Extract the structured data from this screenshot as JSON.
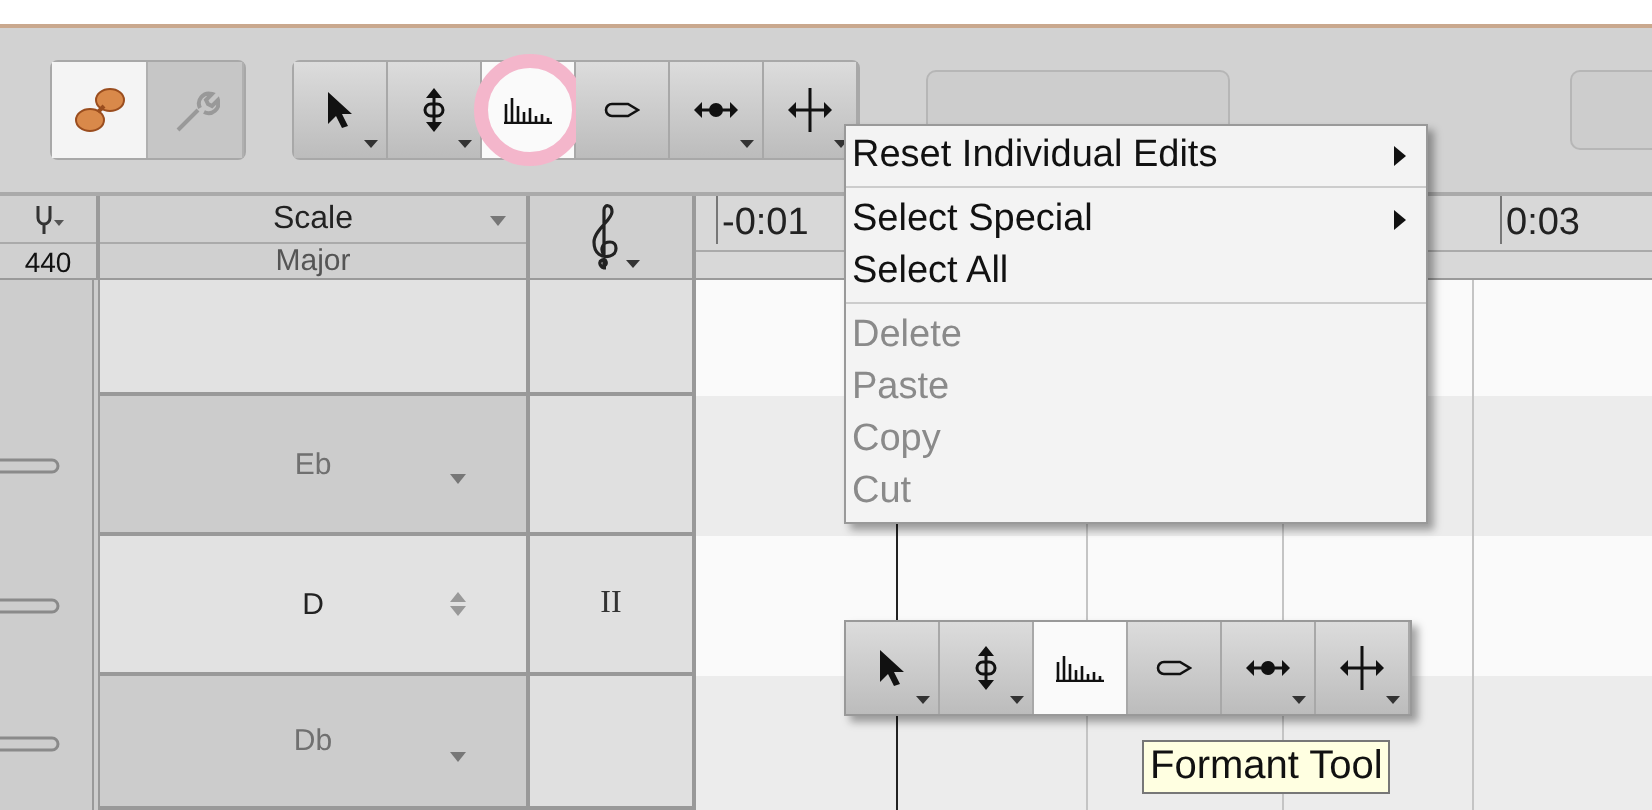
{
  "mode_toggles": [
    {
      "kind": "blobs",
      "selected": true
    },
    {
      "kind": "wrench",
      "selected": false
    }
  ],
  "tools": [
    {
      "kind": "pointer",
      "dropdown": true,
      "selected": false,
      "highlighted": false
    },
    {
      "kind": "pitch",
      "dropdown": true,
      "selected": false,
      "highlighted": false
    },
    {
      "kind": "formant",
      "dropdown": false,
      "selected": true,
      "highlighted": true
    },
    {
      "kind": "amplitude",
      "dropdown": false,
      "selected": false,
      "highlighted": false
    },
    {
      "kind": "timing",
      "dropdown": true,
      "selected": false,
      "highlighted": false
    },
    {
      "kind": "sibilant",
      "dropdown": true,
      "selected": false,
      "highlighted": false
    }
  ],
  "header": {
    "tuning": {
      "reference": "440"
    },
    "scale": {
      "label": "Scale",
      "value": "Major"
    },
    "ticks": [
      "-0:01",
      "0:03"
    ]
  },
  "rows": [
    {
      "in_scale": true
    },
    {
      "note": "Eb",
      "in_scale": false
    },
    {
      "note": "D",
      "in_scale": true,
      "degree": "II"
    },
    {
      "note": "Db",
      "in_scale": false
    }
  ],
  "context_menu": {
    "items": [
      {
        "label": "Reset Individual Edits",
        "submenu": true,
        "disabled": false,
        "separator_after": true
      },
      {
        "label": "Select Special",
        "submenu": true,
        "disabled": false,
        "separator_after": false
      },
      {
        "label": "Select All",
        "submenu": false,
        "disabled": false,
        "separator_after": true
      },
      {
        "label": "Delete",
        "submenu": false,
        "disabled": true,
        "separator_after": false
      },
      {
        "label": "Paste",
        "submenu": false,
        "disabled": true,
        "separator_after": false
      },
      {
        "label": "Copy",
        "submenu": false,
        "disabled": true,
        "separator_after": false
      },
      {
        "label": "Cut",
        "submenu": false,
        "disabled": true,
        "separator_after": false
      }
    ]
  },
  "palette_tools": [
    {
      "kind": "pointer",
      "dropdown": true,
      "selected": false
    },
    {
      "kind": "pitch",
      "dropdown": true,
      "selected": false
    },
    {
      "kind": "formant",
      "dropdown": false,
      "selected": true
    },
    {
      "kind": "amplitude",
      "dropdown": false,
      "selected": false
    },
    {
      "kind": "timing",
      "dropdown": true,
      "selected": false
    },
    {
      "kind": "sibilant",
      "dropdown": true,
      "selected": false
    }
  ],
  "tooltip": "Formant Tool"
}
